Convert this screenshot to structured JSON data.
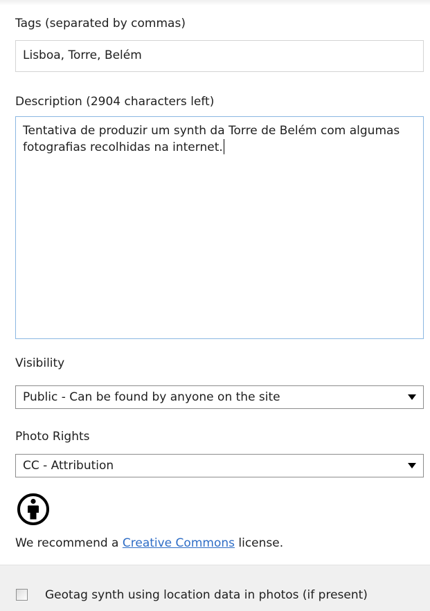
{
  "tags": {
    "label": "Tags (separated by commas)",
    "value": "Lisboa, Torre, Belém"
  },
  "description": {
    "label": "Description (2904 characters left)",
    "value": "Tentativa de produzir um synth da Torre de Belém com algumas fotografias recolhidas na internet."
  },
  "visibility": {
    "label": "Visibility",
    "selected": "Public - Can be found by anyone on the site"
  },
  "photo_rights": {
    "label": "Photo Rights",
    "selected": "CC - Attribution"
  },
  "license": {
    "icon": "cc-attribution-icon",
    "text_before": "We recommend a ",
    "link_text": "Creative Commons",
    "text_after": " license."
  },
  "geotag": {
    "checked": false,
    "label": "Geotag synth using location data in photos (if present)"
  },
  "colors": {
    "link": "#2e6dc6",
    "focus_border": "#8ab7e2",
    "footer_bg": "#f0f0f0"
  }
}
